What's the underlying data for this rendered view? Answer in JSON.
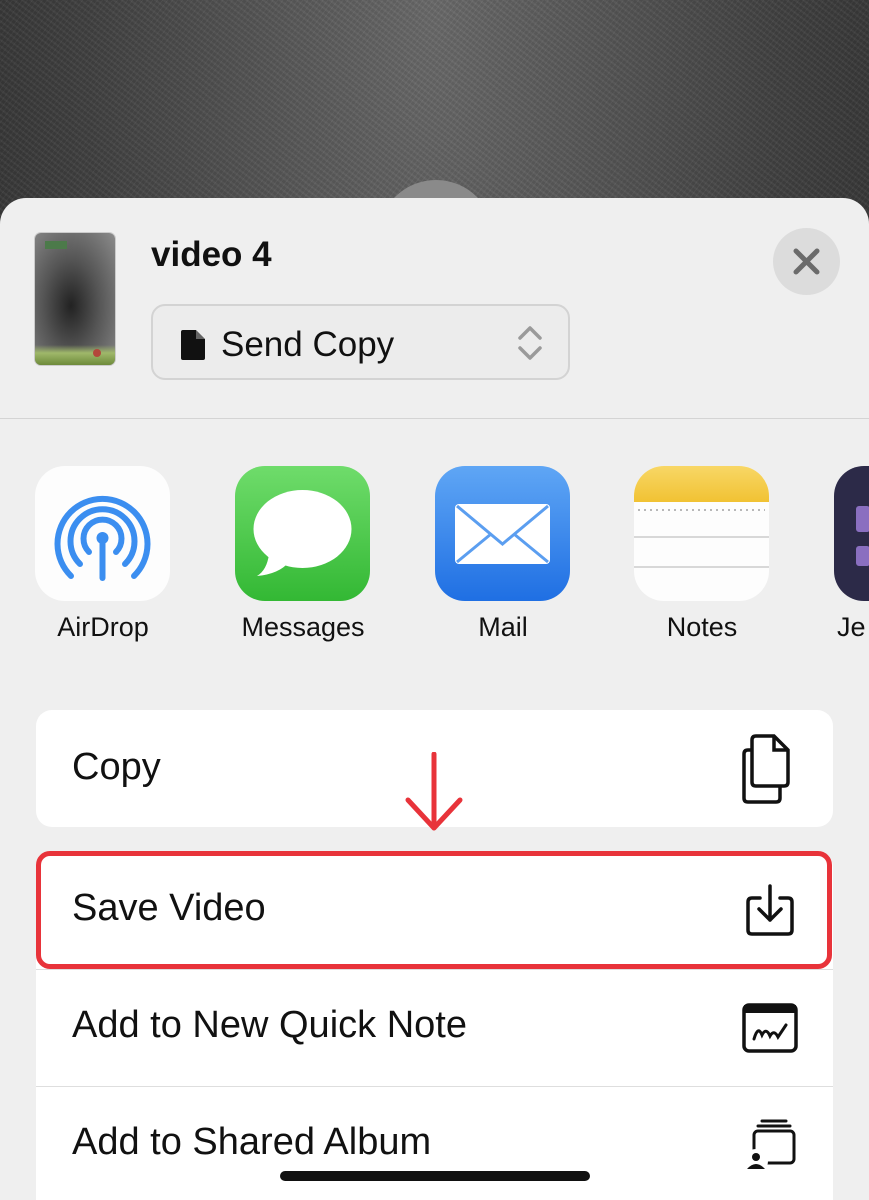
{
  "share_sheet": {
    "title": "video 4",
    "mode_select": {
      "value": "Send Copy"
    },
    "apps": [
      {
        "label": "AirDrop",
        "icon": "airdrop-icon"
      },
      {
        "label": "Messages",
        "icon": "messages-icon"
      },
      {
        "label": "Mail",
        "icon": "mail-icon"
      },
      {
        "label": "Notes",
        "icon": "notes-icon"
      },
      {
        "label": "Je",
        "icon": "app-icon"
      }
    ],
    "actions": [
      {
        "label": "Copy",
        "icon": "copy-icon"
      },
      {
        "label": "Save Video",
        "icon": "save-icon"
      },
      {
        "label": "Add to New Quick Note",
        "icon": "quick-note-icon"
      },
      {
        "label": "Add to Shared Album",
        "icon": "shared-album-icon"
      }
    ]
  },
  "colors": {
    "highlight": "#e8333a",
    "sheet_background": "#efefef"
  }
}
